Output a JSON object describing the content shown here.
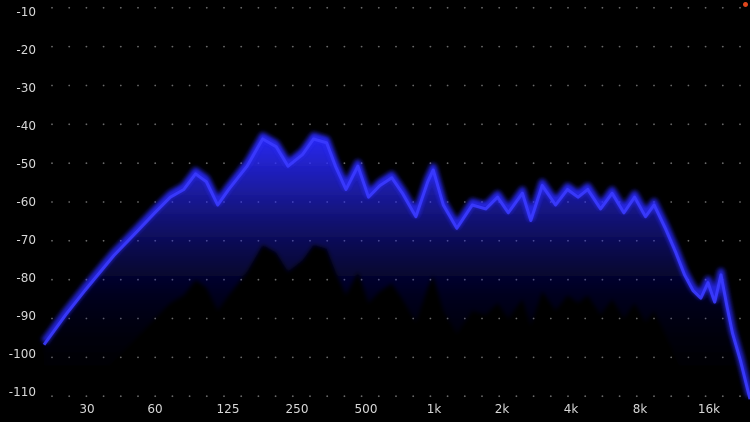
{
  "chart_data": {
    "type": "area",
    "title": "",
    "xlabel": "",
    "ylabel": "",
    "x_scale": "log",
    "xlim": [
      20,
      22000
    ],
    "ylim": [
      -112,
      -8
    ],
    "grid": "dotted",
    "x_ticks": [
      {
        "value": 30,
        "label": "30"
      },
      {
        "value": 60,
        "label": "60"
      },
      {
        "value": 125,
        "label": "125"
      },
      {
        "value": 250,
        "label": "250"
      },
      {
        "value": 500,
        "label": "500"
      },
      {
        "value": 1000,
        "label": "1k"
      },
      {
        "value": 2000,
        "label": "2k"
      },
      {
        "value": 4000,
        "label": "4k"
      },
      {
        "value": 8000,
        "label": "8k"
      },
      {
        "value": 16000,
        "label": "16k"
      }
    ],
    "y_ticks": [
      {
        "value": -10,
        "label": "-10"
      },
      {
        "value": -20,
        "label": "-20"
      },
      {
        "value": -30,
        "label": "-30"
      },
      {
        "value": -40,
        "label": "-40"
      },
      {
        "value": -50,
        "label": "-50"
      },
      {
        "value": -60,
        "label": "-60"
      },
      {
        "value": -70,
        "label": "-70"
      },
      {
        "value": -80,
        "label": "-80"
      },
      {
        "value": -90,
        "label": "-90"
      },
      {
        "value": -100,
        "label": "-100"
      },
      {
        "value": -110,
        "label": "-110"
      }
    ],
    "series": [
      {
        "color": "#2a2aff",
        "peak": [
          {
            "x": 20,
            "y": -96
          },
          {
            "x": 25,
            "y": -88
          },
          {
            "x": 30,
            "y": -82
          },
          {
            "x": 40,
            "y": -73
          },
          {
            "x": 50,
            "y": -67
          },
          {
            "x": 60,
            "y": -62
          },
          {
            "x": 70,
            "y": -58
          },
          {
            "x": 80,
            "y": -56
          },
          {
            "x": 90,
            "y": -52
          },
          {
            "x": 100,
            "y": -54
          },
          {
            "x": 112,
            "y": -60
          },
          {
            "x": 125,
            "y": -56
          },
          {
            "x": 150,
            "y": -50
          },
          {
            "x": 175,
            "y": -43
          },
          {
            "x": 200,
            "y": -45
          },
          {
            "x": 225,
            "y": -50
          },
          {
            "x": 260,
            "y": -47
          },
          {
            "x": 290,
            "y": -43
          },
          {
            "x": 330,
            "y": -44
          },
          {
            "x": 360,
            "y": -50
          },
          {
            "x": 400,
            "y": -56
          },
          {
            "x": 450,
            "y": -50
          },
          {
            "x": 500,
            "y": -58
          },
          {
            "x": 560,
            "y": -55
          },
          {
            "x": 630,
            "y": -53
          },
          {
            "x": 700,
            "y": -57
          },
          {
            "x": 800,
            "y": -63
          },
          {
            "x": 900,
            "y": -54
          },
          {
            "x": 950,
            "y": -51
          },
          {
            "x": 1050,
            "y": -60
          },
          {
            "x": 1200,
            "y": -66
          },
          {
            "x": 1400,
            "y": -60
          },
          {
            "x": 1600,
            "y": -61
          },
          {
            "x": 1800,
            "y": -58
          },
          {
            "x": 2000,
            "y": -62
          },
          {
            "x": 2300,
            "y": -57
          },
          {
            "x": 2500,
            "y": -64
          },
          {
            "x": 2800,
            "y": -55
          },
          {
            "x": 3200,
            "y": -60
          },
          {
            "x": 3600,
            "y": -56
          },
          {
            "x": 4000,
            "y": -58
          },
          {
            "x": 4400,
            "y": -56
          },
          {
            "x": 5000,
            "y": -61
          },
          {
            "x": 5600,
            "y": -57
          },
          {
            "x": 6300,
            "y": -62
          },
          {
            "x": 7000,
            "y": -58
          },
          {
            "x": 7800,
            "y": -63
          },
          {
            "x": 8500,
            "y": -60
          },
          {
            "x": 9500,
            "y": -66
          },
          {
            "x": 10500,
            "y": -72
          },
          {
            "x": 11500,
            "y": -78
          },
          {
            "x": 12500,
            "y": -82
          },
          {
            "x": 13500,
            "y": -84
          },
          {
            "x": 14500,
            "y": -80
          },
          {
            "x": 15500,
            "y": -85
          },
          {
            "x": 16500,
            "y": -78
          },
          {
            "x": 17500,
            "y": -86
          },
          {
            "x": 18500,
            "y": -93
          },
          {
            "x": 20000,
            "y": -100
          },
          {
            "x": 22000,
            "y": -110
          }
        ]
      }
    ]
  },
  "status_indicator": {
    "color": "#e0461c"
  }
}
